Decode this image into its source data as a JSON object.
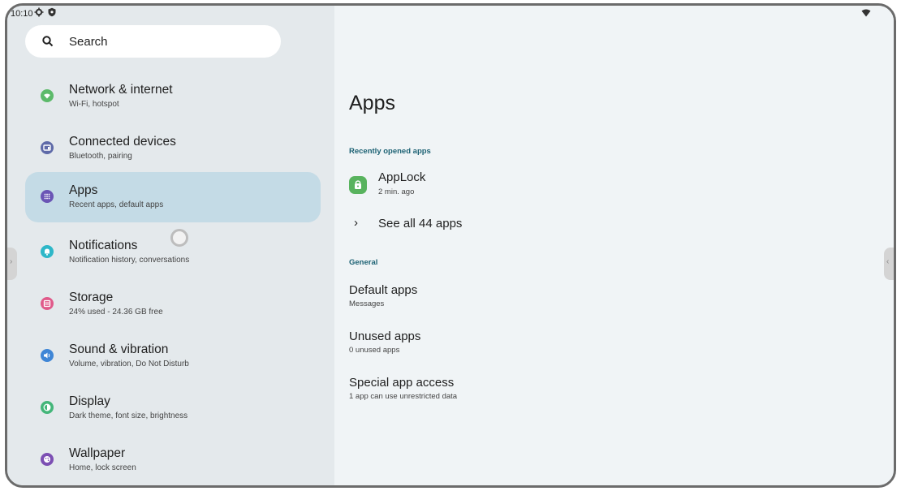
{
  "status_bar": {
    "time": "10:10"
  },
  "search": {
    "placeholder": "Search"
  },
  "nav": [
    {
      "title": "Network & internet",
      "subtitle": "Wi-Fi, hotspot",
      "icon": "wifi-icon",
      "color": "#5cba6a"
    },
    {
      "title": "Connected devices",
      "subtitle": "Bluetooth, pairing",
      "icon": "devices-icon",
      "color": "#5e6aa8"
    },
    {
      "title": "Apps",
      "subtitle": "Recent apps, default apps",
      "icon": "apps-grid-icon",
      "color": "#6a55b5",
      "selected": true
    },
    {
      "title": "Notifications",
      "subtitle": "Notification history, conversations",
      "icon": "bell-icon",
      "color": "#2eb7c8"
    },
    {
      "title": "Storage",
      "subtitle": "24% used - 24.36 GB free",
      "icon": "storage-icon",
      "color": "#e05a8a"
    },
    {
      "title": "Sound & vibration",
      "subtitle": "Volume, vibration, Do Not Disturb",
      "icon": "speaker-icon",
      "color": "#3f86d6"
    },
    {
      "title": "Display",
      "subtitle": "Dark theme, font size, brightness",
      "icon": "brightness-icon",
      "color": "#44b67a"
    },
    {
      "title": "Wallpaper",
      "subtitle": "Home, lock screen",
      "icon": "palette-icon",
      "color": "#7c4fb3"
    }
  ],
  "main": {
    "title": "Apps",
    "recent_section": "Recently opened apps",
    "recent_app": {
      "name": "AppLock",
      "time": "2 min. ago",
      "icon": "applock-icon"
    },
    "see_all": "See all 44 apps",
    "general_section": "General",
    "prefs": [
      {
        "title": "Default apps",
        "subtitle": "Messages"
      },
      {
        "title": "Unused apps",
        "subtitle": "0 unused apps"
      },
      {
        "title": "Special app access",
        "subtitle": "1 app can use unrestricted data"
      }
    ]
  }
}
